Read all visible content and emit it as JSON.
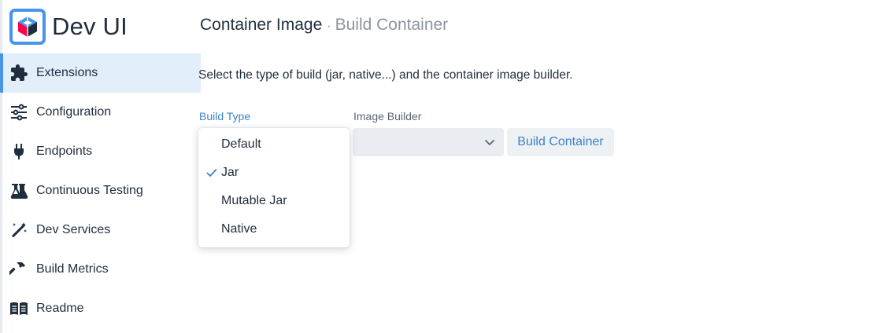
{
  "app": {
    "title": "Dev UI",
    "accent_color": "#4695eb"
  },
  "sidebar": {
    "items": [
      {
        "label": "Extensions",
        "icon": "puzzle-icon",
        "active": true
      },
      {
        "label": "Configuration",
        "icon": "sliders-icon",
        "active": false
      },
      {
        "label": "Endpoints",
        "icon": "plug-icon",
        "active": false
      },
      {
        "label": "Continuous Testing",
        "icon": "flask-icon",
        "active": false
      },
      {
        "label": "Dev Services",
        "icon": "magic-wand-icon",
        "active": false
      },
      {
        "label": "Build Metrics",
        "icon": "hammer-icon",
        "active": false
      },
      {
        "label": "Readme",
        "icon": "book-icon",
        "active": false
      }
    ]
  },
  "header": {
    "title": "Container Image",
    "separator": "·",
    "subtitle": "Build Container"
  },
  "main": {
    "description": "Select the type of build (jar, native...) and the container image builder.",
    "build_type": {
      "label": "Build Type",
      "selected": "Jar",
      "options": [
        "Default",
        "Jar",
        "Mutable Jar",
        "Native"
      ]
    },
    "image_builder": {
      "label": "Image Builder",
      "value": ""
    },
    "build_button": "Build Container"
  }
}
